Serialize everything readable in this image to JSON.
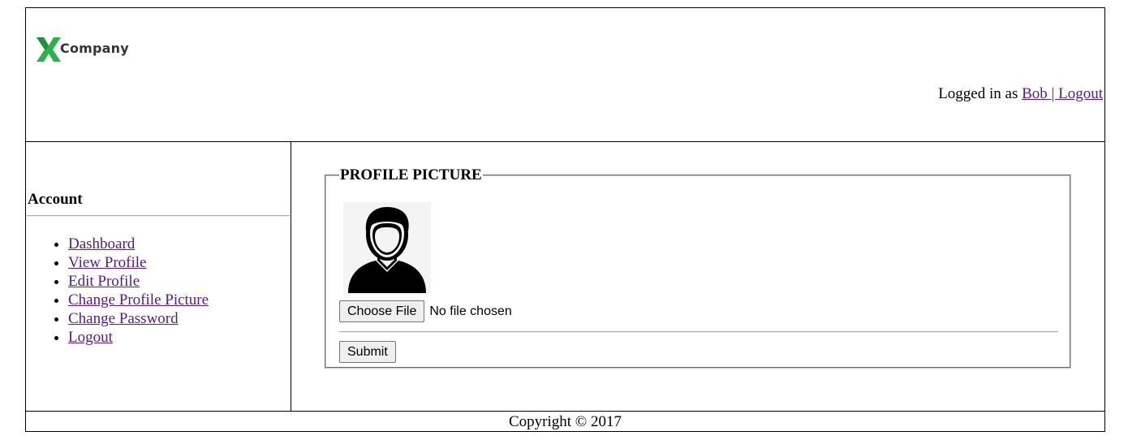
{
  "header": {
    "logo_text": "Company",
    "logged_in_prefix": "Logged in as ",
    "username": "Bob ",
    "separator": "| ",
    "logout_label": "Logout"
  },
  "sidebar": {
    "title": "Account",
    "items": [
      {
        "label": "Dashboard"
      },
      {
        "label": "View Profile"
      },
      {
        "label": "Edit Profile"
      },
      {
        "label": "Change Profile Picture"
      },
      {
        "label": "Change Password"
      },
      {
        "label": "Logout"
      }
    ]
  },
  "main": {
    "legend": "PROFILE PICTURE",
    "choose_file_label": "Choose File",
    "file_status": "No file chosen",
    "submit_label": "Submit"
  },
  "footer": {
    "copyright": "Copyright © 2017"
  },
  "colors": {
    "logo_green": "#2bb24c",
    "link": "#551a8b"
  }
}
